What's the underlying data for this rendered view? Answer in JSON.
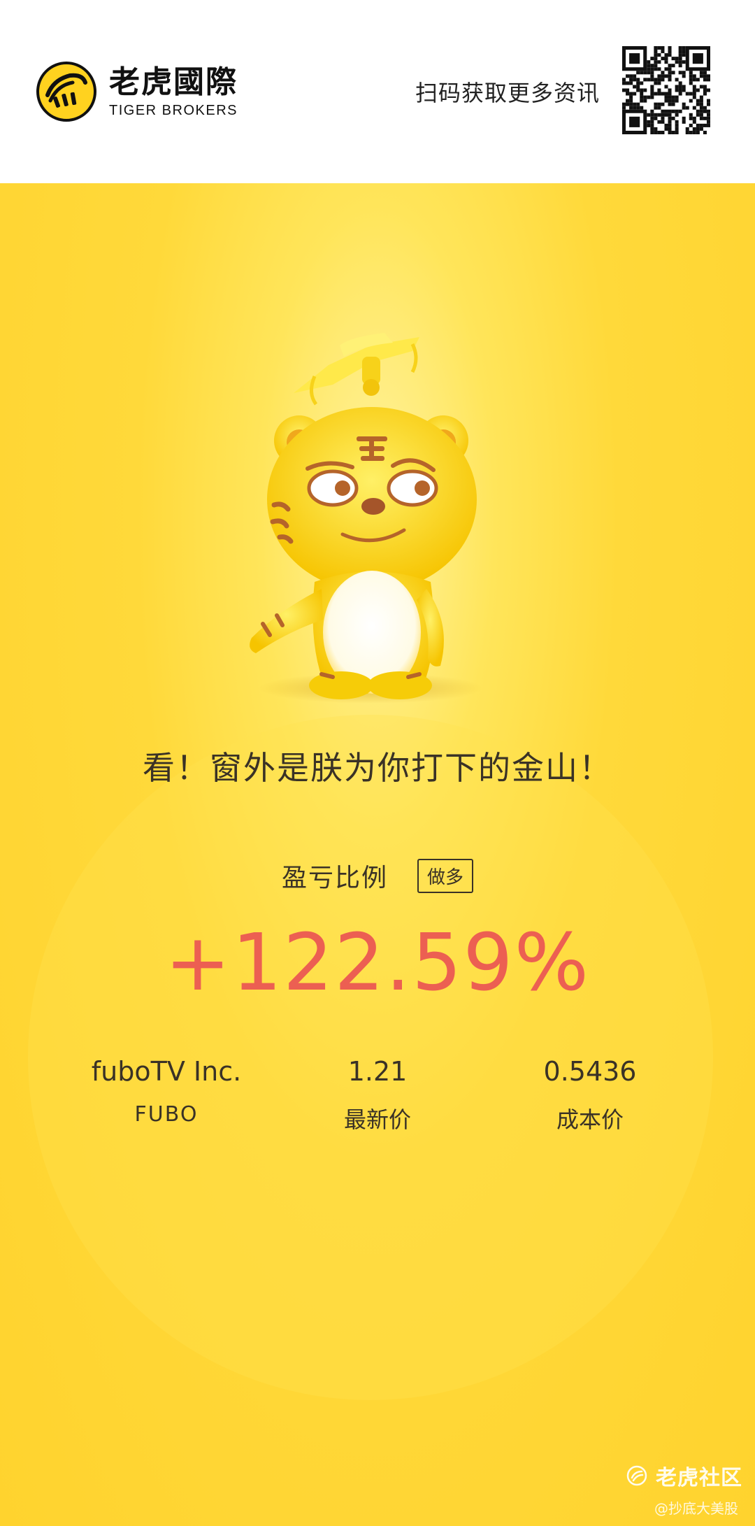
{
  "header": {
    "brand_name_cn": "老虎國際",
    "brand_name_en": "TIGER BROKERS",
    "qr_hint": "扫码获取更多资讯",
    "logo_icon": "tiger-logo-icon",
    "qr_icon": "qr-code-icon"
  },
  "hero": {
    "mascot_icon": "tiger-mascot-illustration",
    "slogan": "看！窗外是朕为你打下的金山！"
  },
  "position": {
    "ratio_label": "盈亏比例",
    "direction": "做多",
    "ratio_value": "+122.59%",
    "stock": {
      "name": "fuboTV Inc.",
      "ticker": "FUBO"
    },
    "latest_price": {
      "value": "1.21",
      "label": "最新价"
    },
    "cost_price": {
      "value": "0.5436",
      "label": "成本价"
    }
  },
  "watermark": {
    "title": "老虎社区",
    "subtitle": "@抄底大美股"
  },
  "colors": {
    "background_yellow": "#ffd32e",
    "profit_red": "#ec5f52",
    "text_dark": "#3a3226"
  }
}
